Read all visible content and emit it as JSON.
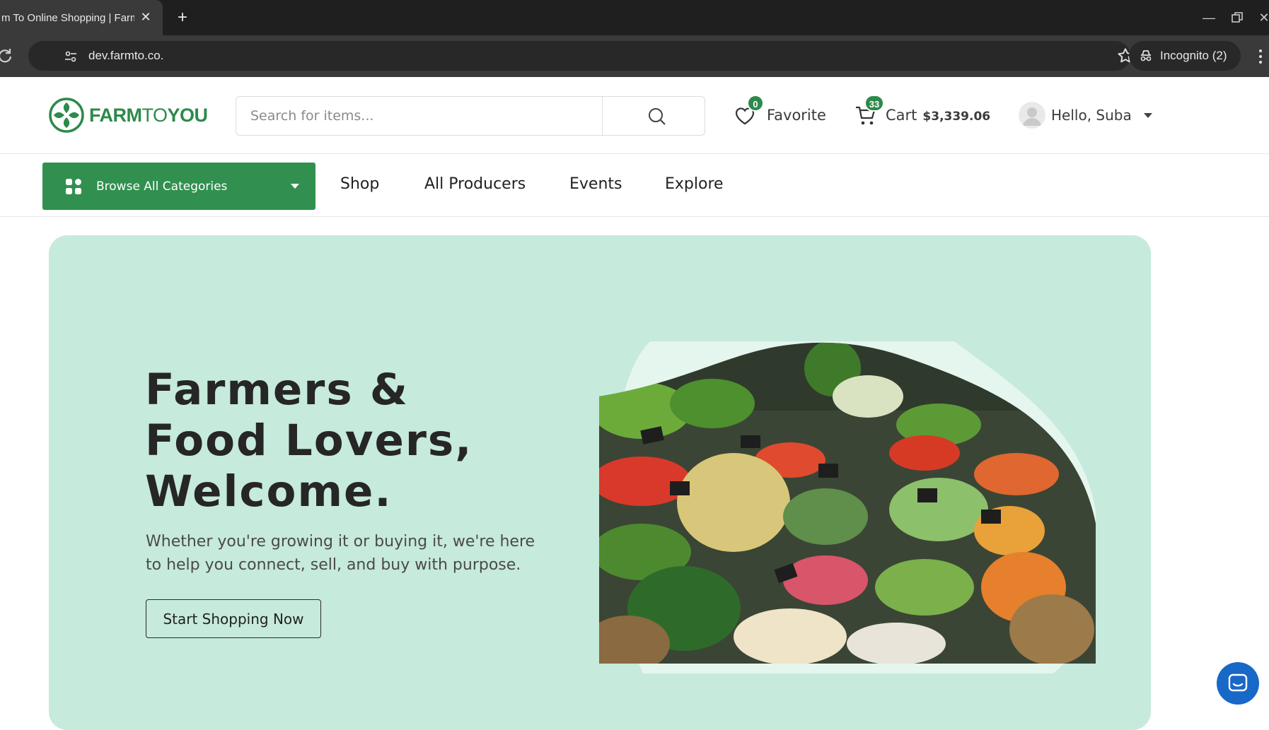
{
  "browser": {
    "tab_title": "m To Online Shopping | Farm",
    "url": "dev.farmto.co.",
    "incognito_label": "Incognito (2)"
  },
  "header": {
    "logo": {
      "part1": "FARM",
      "part2": "TO",
      "part3": "YOU"
    },
    "search_placeholder": "Search for items...",
    "favorite": {
      "label": "Favorite",
      "count": "0"
    },
    "cart": {
      "label": "Cart",
      "total": "$3,339.06",
      "count": "33"
    },
    "user": {
      "greeting": "Hello, Suba"
    }
  },
  "nav": {
    "browse_label": "Browse All Categories",
    "links": [
      "Shop",
      "All Producers",
      "Events",
      "Explore"
    ]
  },
  "hero": {
    "title": "Farmers & Food Lovers, Welcome.",
    "subtitle": "Whether you're growing it or buying it, we're here to help you connect, sell, and buy with purpose.",
    "cta": "Start Shopping Now"
  },
  "colors": {
    "brand_green": "#31904f",
    "hero_bg": "#c6eadb",
    "chat_blue": "#1868c7"
  }
}
